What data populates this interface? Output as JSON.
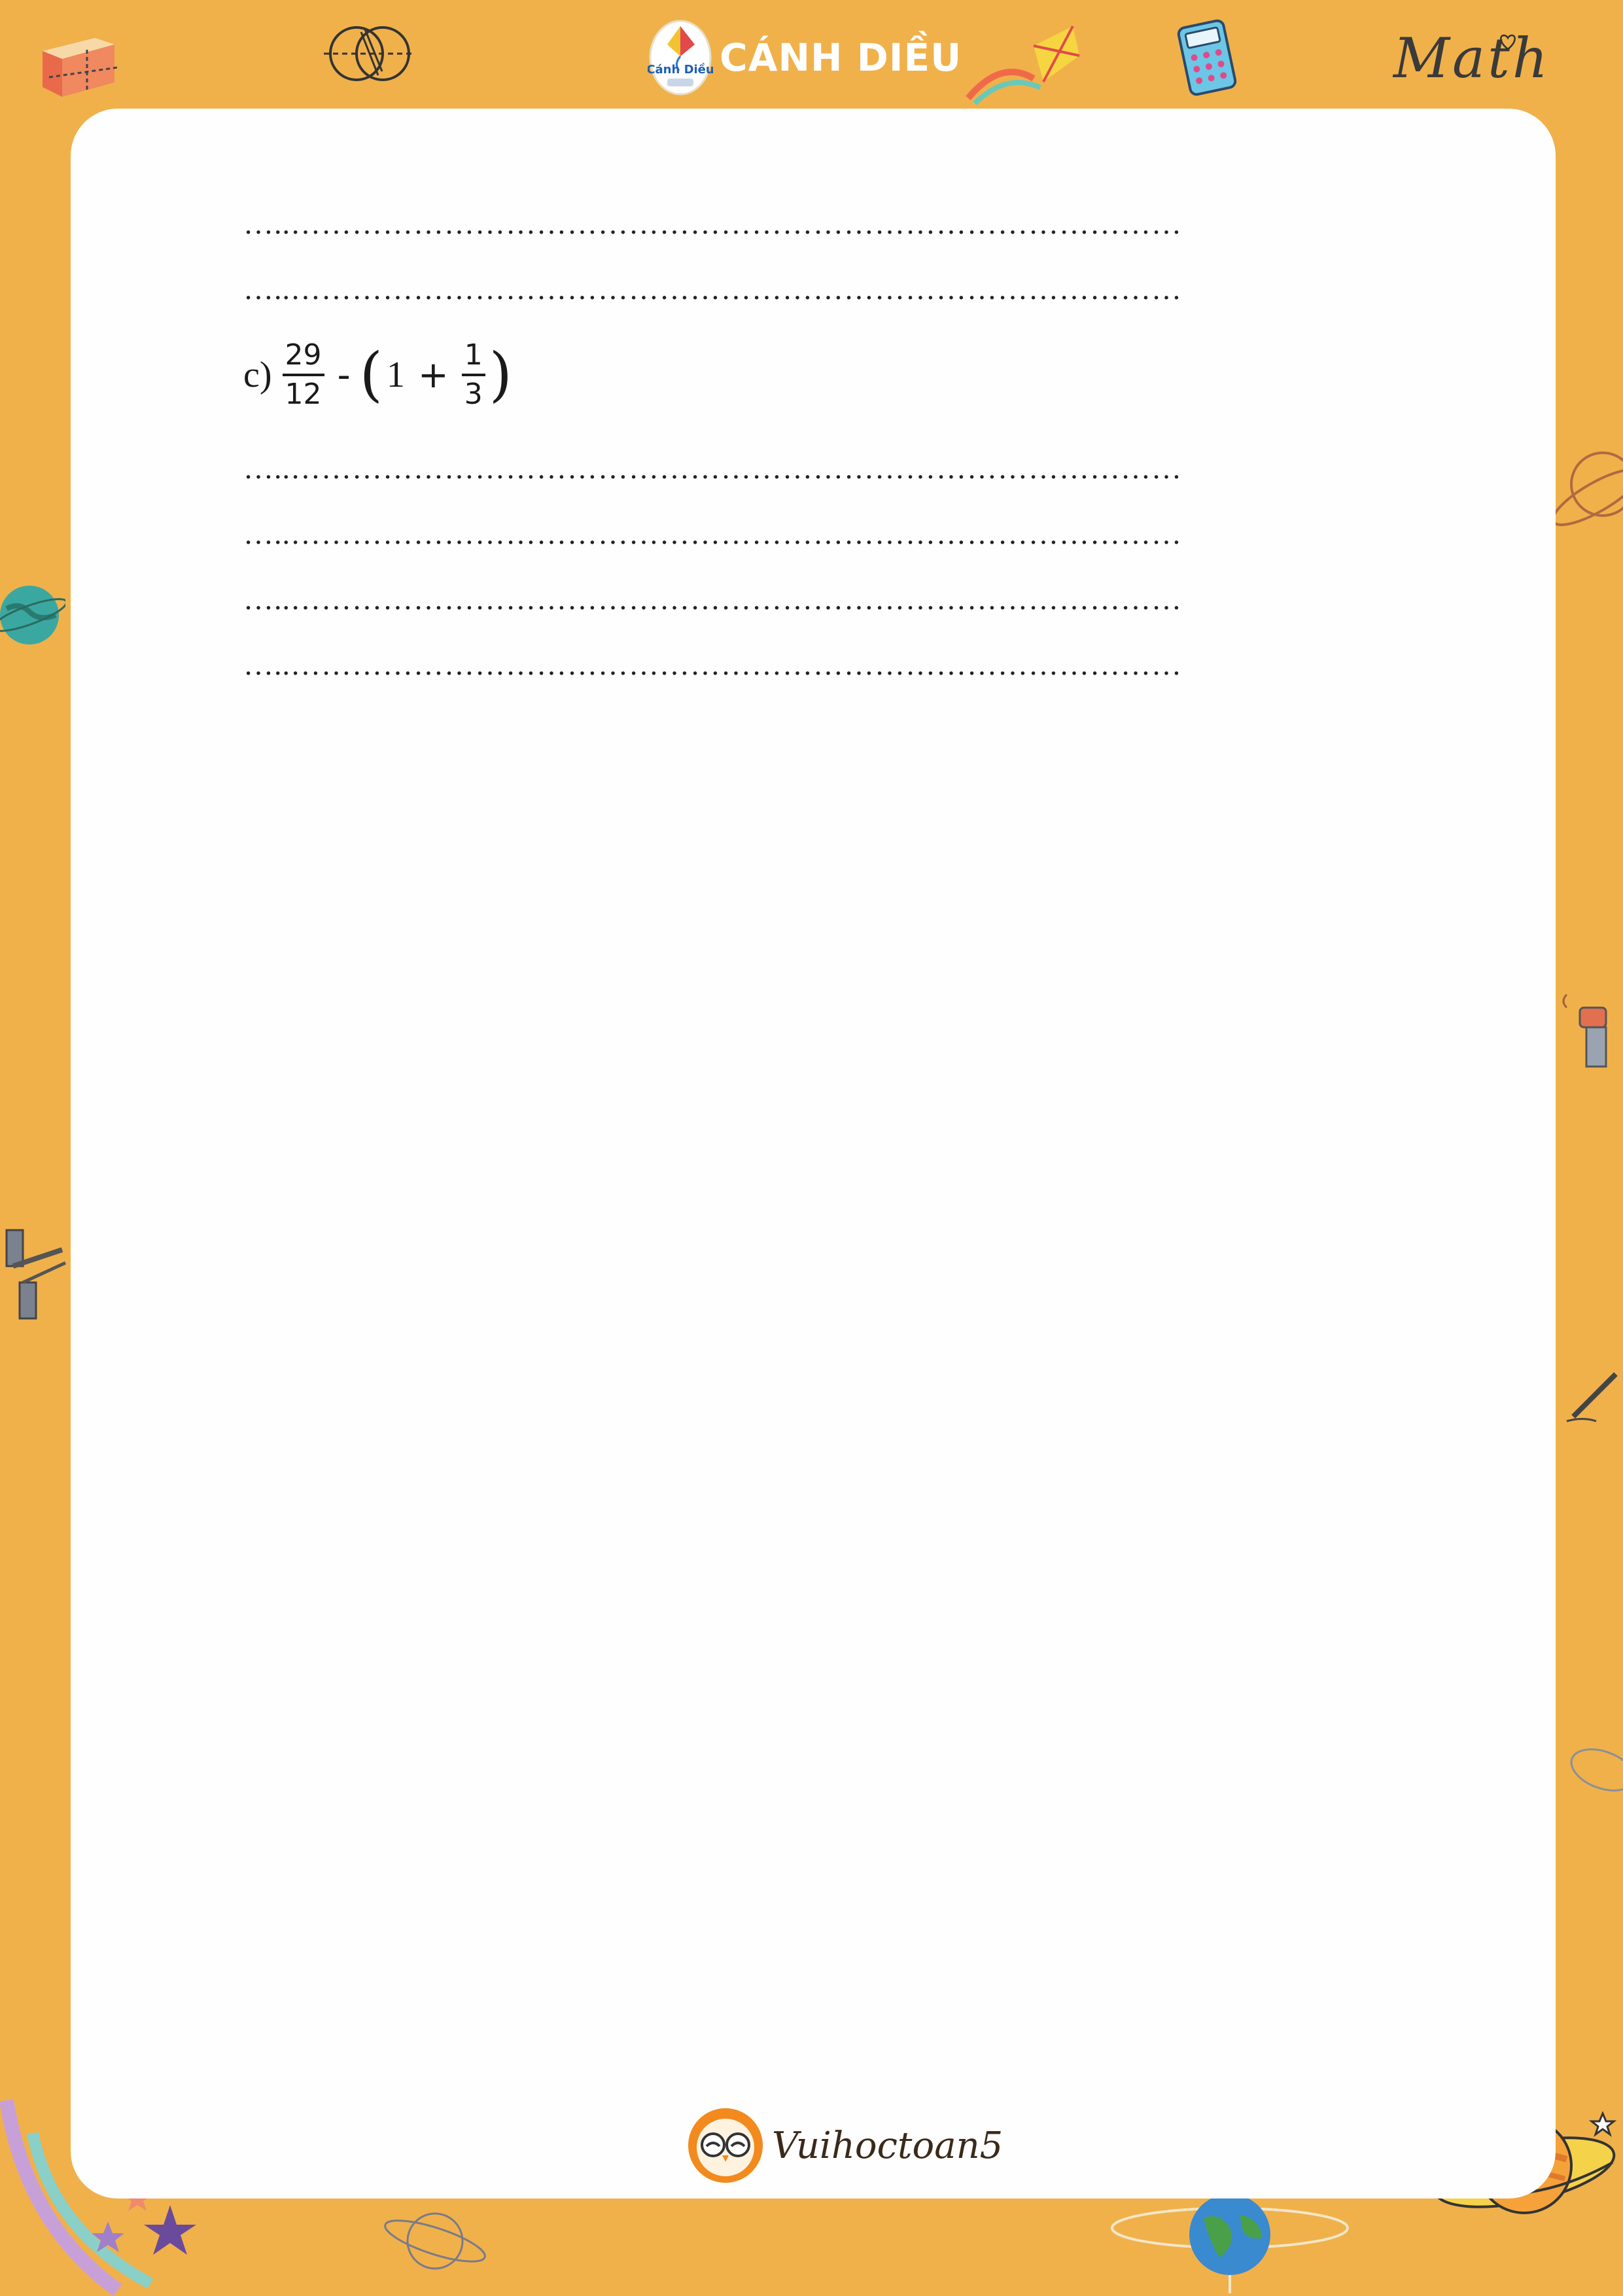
{
  "header": {
    "brand_title": "CÁNH DIỀU",
    "logo_caption": "Cánh Diều",
    "math_word": "Math",
    "icons": [
      "ruler-box-icon",
      "venn-diagram-icon",
      "kite-logo-icon",
      "kite-icon",
      "calculator-icon",
      "heart-icon"
    ]
  },
  "worksheet": {
    "dotted_line": "…..……………………………………………………………………………",
    "exercise_c": {
      "label": "c)",
      "fraction_a": {
        "numerator": "29",
        "denominator": "12"
      },
      "minus": "-",
      "open_paren": "(",
      "whole": "1",
      "plus": "+",
      "fraction_b": {
        "numerator": "1",
        "denominator": "3"
      },
      "close_paren": ")"
    }
  },
  "footer": {
    "brand": "Vuihoctoan5",
    "icon": "owl-icon"
  },
  "colors": {
    "frame": "#f0b14b",
    "sheet": "#fefefe",
    "text": "#1a1a1a"
  }
}
